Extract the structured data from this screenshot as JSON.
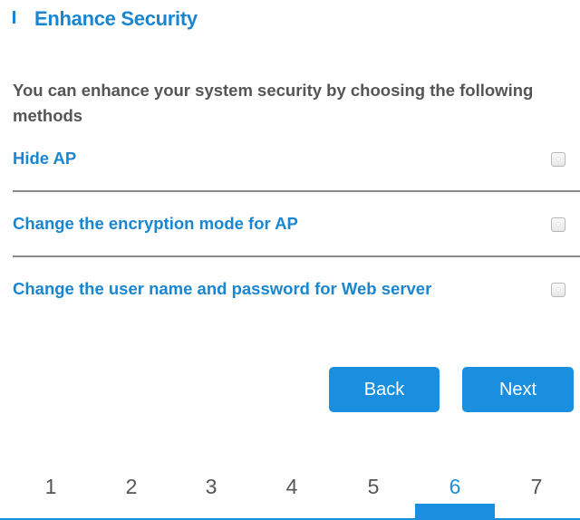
{
  "header": {
    "title": "Enhance Security"
  },
  "description": "You can enhance your system security by choosing the following methods",
  "options": [
    {
      "label": "Hide AP",
      "checked": false
    },
    {
      "label": "Change the encryption mode for AP",
      "checked": false
    },
    {
      "label": "Change the user name and password for Web server",
      "checked": false
    }
  ],
  "buttons": {
    "back_label": "Back",
    "next_label": "Next"
  },
  "steps": {
    "items": [
      "1",
      "2",
      "3",
      "4",
      "5",
      "6",
      "7"
    ],
    "current": "6"
  },
  "colors": {
    "accent": "#1a8fe0",
    "label_blue": "#1a86d0",
    "text_gray": "#555555"
  }
}
